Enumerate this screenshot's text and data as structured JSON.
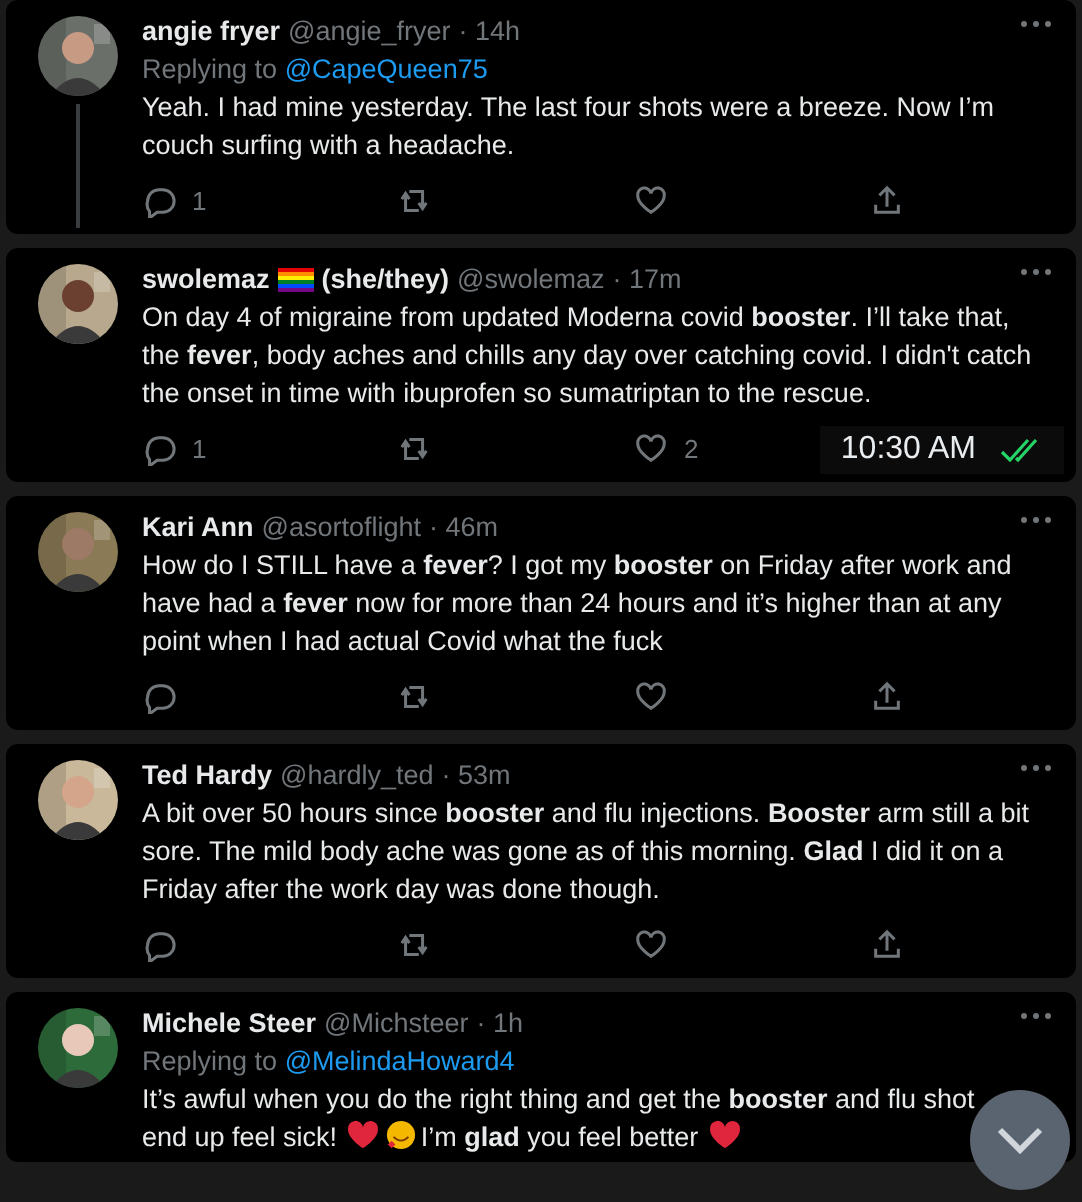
{
  "tweets": [
    {
      "name": "angie fryer",
      "handle": "@angie_fryer",
      "time": "· 14h",
      "thread_line": true,
      "replying_label": "Replying to",
      "replying_to": "@CapeQueen75",
      "body": [
        {
          "kind": "text",
          "text": "Yeah. I had mine yesterday. The last four shots were a breeze. Now I’m couch surfing with a headache."
        }
      ],
      "actions_visible": true,
      "actions": {
        "replies": "1"
      }
    },
    {
      "name": "swolemaz",
      "flag": true,
      "pronouns": "(she/they)",
      "handle": "@swolemaz",
      "time": "· 17m",
      "body": [
        {
          "kind": "text",
          "text": "On day 4 of migraine from updated Moderna covid **booster**. I’ll take that, the **fever**, body aches and chills any day over catching covid. I didn't catch the onset in time with ibuprofen so sumatriptan to the rescue."
        }
      ],
      "actions_visible": true,
      "actions": {
        "replies": "1",
        "likes": "2"
      },
      "overlay_time": "10:30 AM"
    },
    {
      "name": "Kari Ann",
      "handle": "@asortoflight",
      "time": "· 46m",
      "body": [
        {
          "kind": "text",
          "text": "How do I STILL have a **fever**? I got my **booster** on Friday after work and have had a **fever** now for more than 24 hours and it’s higher than at any point when I had actual Covid what the fuck"
        }
      ],
      "actions_visible": true
    },
    {
      "name": "Ted Hardy",
      "handle": "@hardly_ted",
      "time": "· 53m",
      "body": [
        {
          "kind": "text",
          "text": "A bit over 50 hours since **booster** and flu injections. **Booster** arm still a bit sore. The mild body ache was gone as of this morning. **Glad** I did it on a Friday after the work day was done though."
        }
      ],
      "actions_visible": true
    },
    {
      "name": "Michele Steer",
      "handle": "@Michsteer",
      "time": "· 1h",
      "replying_label": "Replying to",
      "replying_to": "@MelindaHoward4",
      "body": [
        {
          "kind": "text",
          "text": "It’s awful when you do the right thing and get the **booster** and flu shot"
        },
        {
          "kind": "break"
        },
        {
          "kind": "text",
          "text": "end up feel sick!"
        },
        {
          "kind": "heart"
        },
        {
          "kind": "smiling-face"
        },
        {
          "kind": "text",
          "text": "I’m **glad** you feel better"
        },
        {
          "kind": "heart"
        }
      ]
    }
  ]
}
